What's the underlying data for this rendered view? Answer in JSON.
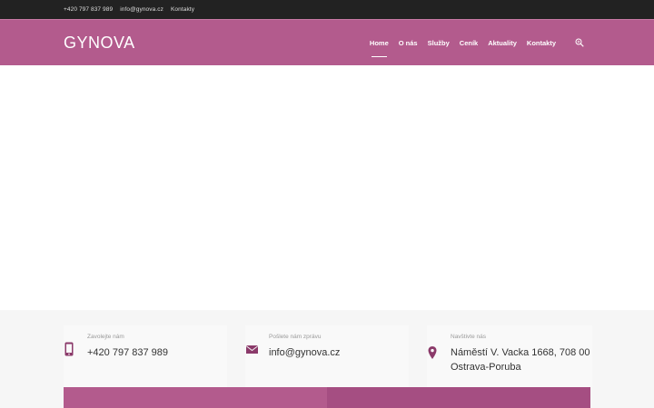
{
  "topbar": {
    "phone": "+420 797 837 989",
    "email": "info@gynova.cz",
    "contacts": "Kontakty"
  },
  "header": {
    "logo": "GYNOVA",
    "nav": [
      {
        "label": "Home",
        "active": true
      },
      {
        "label": "O nás"
      },
      {
        "label": "Služby"
      },
      {
        "label": "Ceník"
      },
      {
        "label": "Aktuality"
      },
      {
        "label": "Kontakty"
      }
    ],
    "search_icon": "search-icon"
  },
  "contact": {
    "call": {
      "label": "Zavolejte nám",
      "value": "+420 797 837 989",
      "icon": "phone-icon"
    },
    "mail": {
      "label": "Pošlete nám zprávu",
      "value": "info@gynova.cz",
      "icon": "envelope-icon"
    },
    "visit": {
      "label": "Navštivte nás",
      "value": "Náměstí V. Vacka 1668, 708 00 Ostrava-Poruba",
      "icon": "map-pin-icon"
    }
  },
  "colors": {
    "brand": "#b35b8d",
    "brand_dark": "#a54e82",
    "icon": "#8b3a6a",
    "topbar": "#222222"
  }
}
